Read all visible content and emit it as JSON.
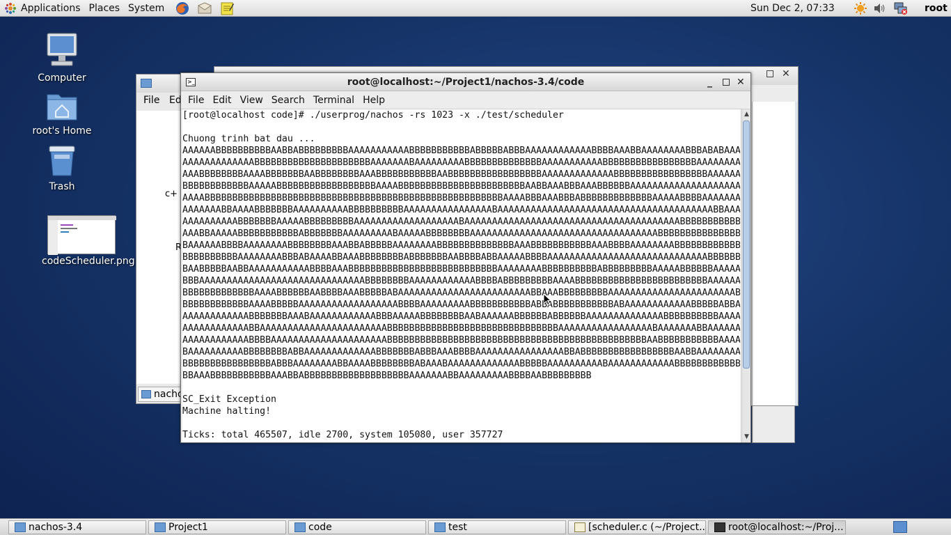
{
  "top_panel": {
    "menus": [
      "Applications",
      "Places",
      "System"
    ],
    "clock": "Sun Dec  2, 07:33",
    "user": "root"
  },
  "desktop": {
    "icons": [
      {
        "label": "Computer"
      },
      {
        "label": "root's Home"
      },
      {
        "label": "Trash"
      },
      {
        "label": "codeScheduler.png"
      }
    ]
  },
  "bg_window": {
    "menu_file": "File",
    "menu_edit_partial": "Ed",
    "fragment_c": "c+",
    "fragment_r": "R",
    "tab_partial": "nacho"
  },
  "terminal": {
    "title": "root@localhost:~/Project1/nachos-3.4/code",
    "menus": [
      "File",
      "Edit",
      "View",
      "Search",
      "Terminal",
      "Help"
    ],
    "lines": [
      "[root@localhost code]# ./userprog/nachos -rs 1023 -x ./test/scheduler",
      "",
      "Chuong trinh bat dau ...",
      "AAAAAABBBBBBBBBBAABBABBBBBBBBBAAAAAAAAAAABBBBBBBBBBBABBBBBABBBAAAAAAAAAAAABBBBAAABBAAAAAAAABBBABABAAAA",
      "AAAAAAAAAAAAABBBBBBBBBBBBBBBBBBBBBAAAAAAABAAAAAAAAABBBBBBBBBBBBBBAAAAAAAAAAABBBBBBBBBBBBBBBBBAAAAAAAA",
      "AAABBBBBBBBAAAABBBBBBBAABBBBBBBBAAABBBBBBBBBBBAABBBBBBBBBBBBBBBBBAAAAAAAAAAAAABBBBBBBBBBBBBBBBBAAAAAAB",
      "BBBBBBBBBBBBAAAAABBBBBBBBBBBBBBBBBBAAAABBBBBBBBBBBBBBBBBBBBBBBAABBAAABBBAAABBBBBBAAAAAAAAAAAAAAAAAAAAA",
      "AAAABBBBBBBBBBBBBBBBBBBBBBBBBBBBBBBBBBBBBBBBBBBBBBBBBBBBBBAAAABBBAAABBBABBBBBBBBBBBBBAAAAABBBBAAAAAAAA",
      "AAAAAAABBAAAABBBBBBBAAAAAAAAAABBBBBBBBBBAAAAAAAAAAAAAAAABAAAAAAAAAAAAAAAAAAAAAAAAAAAAAAAAAAAAAAABBAAAA",
      "AAAAAAAAAABBBBBBBAAAAABBBBBBBBBAAAAAAAAAAAAAAAAAAABAAAAAAAAAAAAAAAAAAAAAAAAAAAAAAAAAAAAAAABBBBBBBBBBB",
      "AAABBAAAAABBBBBBBBBBBABBBBBBBAAAAAAAAABAAAAABBBBBBBBAAAAAAAAAAAAAAAAAAAAAAAAAAAAAAAAAABBBBBBBBBBBBBBBB",
      "BAAAAAABBBBAAAAAAAABBBBBBBBAAABBABBBBBAAAAAAAABBBBBBBBBBBBBBAAABBBBBBBBBBBAAABBBBAAAAAAAABBBBBBBBBBBBB",
      "BBBBBBBBBBAAAAAAAABBBABAAAABBAAABBBBBBBBABBBBBBBAABBBBABBAAAAABBBBAAAAAAAAAAAAAAAAAAAAAAAAAAAAABBBBBB",
      "BAABBBBBAABBAAAAAAAAAAABBBBAAABBBBBBBBBBBBBBBBBBBBBBBBBBBAAAAAAAABBBBBBBBBBABBBBBBBBBAAAAABBBBBBAAAAAA",
      "BBBAAAAAAAAAAAAAAAAAAAAAAAAAAAAAABBBBBBBBAAAAAAAAAAAABBBBABBBBBBBBBAAAABBBBBBBBBBBBBBBBBBBBBBBBAAAAAAAB",
      "BBBBBBBBBBBBBAAAABBBBBBAABBBBAAABBBBBABAAAAAAAAAAAAAAAAAAAAAAAABBAAABBBBBBBBBAAAAAAAAAAAAAAAAAAAAAAABB",
      "BBBBBBBBBBBBAAAABBBBBAAAAAAAAAAAAAAAAAABBBBAAAAAAAAABBBBBBBBBBBABBABBBBBBBBBBBABAAAAAAAAAAAABBBBBABBA",
      "AAAAAAAAAAAABBBBBBBAAABAAAAAAAAAAAABBBAAAAABBBBBBBBAABAAAAAABBBBBBABBBBBBAAAAAAAAAAAAAABBBBBBBBBBAAAA",
      "AAAAAAAAAAAABBAAAAAAAAAAAAAAAAAAAAAAABBBBBBBBBBBBBBBBBBBBBBBBBBBBBBBAAAAAAAAAAAAAAAAABAAAAAAABBAAAAAAAAAA",
      "AAAAAAAAAAAABBBBAAAAAAAAAAAAAAAAAAAAABBBBBBBBBBBBBBBBBBBBBBBBBBBBBBBBBBBBBBBBBBBBBBBAABBBBBBBBBBBAAAAAAA",
      "BAAAAAAAAAABBBBBBBBABBAAAAAAAAAAAAABBBBBBBABBBAAABBBBAAAAAAAAAAAAAAAABBABBBBBBBBBBBBBBBBBAABBAAAAAAAAB",
      "BBBBBBBBBBBBBBBBABBBAAAAAAAABBAAAABBBBBBBBABAAABAAAAAAAAAAAAABBBBBAAAAAAAAAABAAAAAAAAAAAABBBBBBBBBBBBBB",
      "BBAAABBBBBBBBBBBAAABBABBBBBBBBBBBBBBBBBBBAAAAAAABBAAAAAAAAABBBBAABBBBBBBBB",
      "",
      "SC_Exit Exception",
      "Machine halting!",
      "",
      "Ticks: total 465507, idle 2700, system 105080, user 357727"
    ]
  },
  "taskbar": {
    "tasks": [
      {
        "label": "nachos-3.4"
      },
      {
        "label": "Project1"
      },
      {
        "label": "code"
      },
      {
        "label": "test"
      },
      {
        "label": "[scheduler.c (~/Project..."
      },
      {
        "label": "root@localhost:~/Proj..."
      }
    ]
  }
}
